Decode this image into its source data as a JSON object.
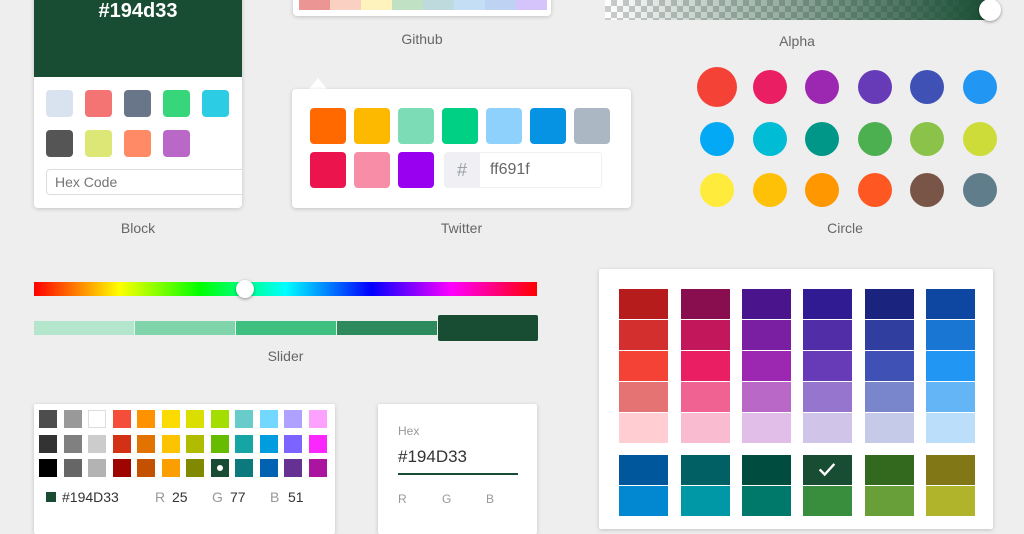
{
  "block": {
    "hex_label": "#194d33",
    "header_color": "#194d33",
    "swatches": [
      "#D9E3F0",
      "#F47373",
      "#697689",
      "#37D67A",
      "#2CCCE4",
      "#555555",
      "#DCE775",
      "#FF8A65",
      "#BA68C8"
    ],
    "input_placeholder": "Hex Code",
    "caption": "Block"
  },
  "github": {
    "swatches": [
      "#EB9694",
      "#FAD0C3",
      "#FEF3BD",
      "#C1E1C5",
      "#BEDADC",
      "#C4DEF6",
      "#BED3F3",
      "#D4C4FB"
    ],
    "caption": "Github"
  },
  "alpha": {
    "color": "#194d33",
    "caption": "Alpha"
  },
  "twitter": {
    "swatches": [
      "#FF6900",
      "#FCB900",
      "#7BDCB5",
      "#00D084",
      "#8ED1FC",
      "#0693E3",
      "#ABB8C3",
      "#EB144C",
      "#F78DA7",
      "#9900EF"
    ],
    "hash": "#",
    "hex_value": "ff691f",
    "caption": "Twitter"
  },
  "circle": {
    "colors": [
      "#f44336",
      "#e91e63",
      "#9c27b0",
      "#673ab7",
      "#3f51b5",
      "#2196f3",
      "#03a9f4",
      "#00bcd4",
      "#009688",
      "#4caf50",
      "#8bc34a",
      "#cddc39",
      "#ffeb3b",
      "#ffc107",
      "#ff9800",
      "#ff5722",
      "#795548",
      "#607d8b"
    ],
    "caption": "Circle"
  },
  "slider": {
    "hue_position": 0.42,
    "shades": [
      "#b3e6cc",
      "#80d4aa",
      "#40c080",
      "#2d8a5c",
      "#194d33"
    ],
    "caption": "Slider"
  },
  "sketch": {
    "grid": [
      [
        "#4D4D4D",
        "#999999",
        "#FFFFFF",
        "#F44E3B",
        "#FE9200",
        "#FCDC00",
        "#DBDF00",
        "#A4DD00",
        "#68CCCA",
        "#73D8FF",
        "#AEA1FF",
        "#FDA1FF"
      ],
      [
        "#333333",
        "#808080",
        "#CCCCCC",
        "#D33115",
        "#E27300",
        "#FCC400",
        "#B0BC00",
        "#68BC00",
        "#16A5A5",
        "#009CE0",
        "#7B64FF",
        "#FA28FF"
      ],
      [
        "#000000",
        "#666666",
        "#B3B3B3",
        "#9F0500",
        "#C45100",
        "#FB9E00",
        "#808900",
        "#194D33",
        "#0C797D",
        "#0062B1",
        "#653294",
        "#AB149E"
      ]
    ],
    "current_color": "#194D33",
    "hex_text": "#194D33",
    "r_label": "R",
    "r_value": "25",
    "g_label": "G",
    "g_value": "77",
    "b_label": "B",
    "b_value": "51"
  },
  "material": {
    "hex_label": "Hex",
    "hex_value": "#194D33",
    "accent": "#194D33",
    "r_label": "R",
    "g_label": "G",
    "b_label": "B"
  },
  "swatches_picker": {
    "groups": [
      [
        "#b71c1c",
        "#d32f2f",
        "#f44336",
        "#e57373",
        "#ffcdd2"
      ],
      [
        "#880e4f",
        "#c2185b",
        "#e91e63",
        "#f06292",
        "#f8bbd0"
      ],
      [
        "#4a148c",
        "#7b1fa2",
        "#9c27b0",
        "#ba68c8",
        "#e1bee7"
      ],
      [
        "#311b92",
        "#512da8",
        "#673ab7",
        "#9575cd",
        "#d1c4e9"
      ],
      [
        "#1a237e",
        "#303f9f",
        "#3f51b5",
        "#7986cb",
        "#c5cae9"
      ],
      [
        "#0d47a1",
        "#1976d2",
        "#2196f3",
        "#64b5f6",
        "#bbdefb"
      ]
    ],
    "groups2": [
      [
        "#01579b",
        "#0288d1"
      ],
      [
        "#006064",
        "#0097a7"
      ],
      [
        "#004d40",
        "#00796b"
      ],
      [
        "#194d33",
        "#388e3c"
      ],
      [
        "#33691e",
        "#689f38"
      ],
      [
        "#827717",
        "#afb42b"
      ]
    ],
    "selected_group": 3,
    "check_icon": "check-icon"
  }
}
